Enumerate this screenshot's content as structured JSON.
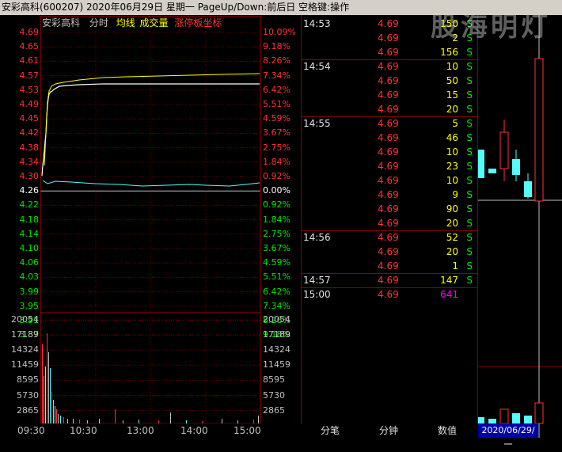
{
  "titlebar": {
    "text": "安彩高科(600207)  2020年06月29日 星期一  PageUp/Down:前后日  空格键:操作"
  },
  "chart_header": {
    "name": "安彩高科",
    "mode": "分时",
    "avg": "均线",
    "volume": "成交量",
    "limit": "涨停板坐标"
  },
  "price_axis": [
    {
      "price": "4.69",
      "pct": "10.09%",
      "color": "red"
    },
    {
      "price": "4.65",
      "pct": "9.18%",
      "color": "red"
    },
    {
      "price": "4.61",
      "pct": "8.26%",
      "color": "red"
    },
    {
      "price": "4.57",
      "pct": "7.34%",
      "color": "red"
    },
    {
      "price": "4.53",
      "pct": "6.42%",
      "color": "red"
    },
    {
      "price": "4.49",
      "pct": "5.51%",
      "color": "red"
    },
    {
      "price": "4.45",
      "pct": "4.59%",
      "color": "red"
    },
    {
      "price": "4.42",
      "pct": "3.67%",
      "color": "red"
    },
    {
      "price": "4.38",
      "pct": "2.75%",
      "color": "red"
    },
    {
      "price": "4.34",
      "pct": "1.84%",
      "color": "red"
    },
    {
      "price": "4.30",
      "pct": "0.92%",
      "color": "red"
    },
    {
      "price": "4.26",
      "pct": "0.00%",
      "color": "white"
    },
    {
      "price": "4.22",
      "pct": "0.92%",
      "color": "green"
    },
    {
      "price": "4.18",
      "pct": "1.84%",
      "color": "green"
    },
    {
      "price": "4.14",
      "pct": "2.75%",
      "color": "green"
    },
    {
      "price": "4.10",
      "pct": "3.67%",
      "color": "green"
    },
    {
      "price": "4.06",
      "pct": "4.59%",
      "color": "green"
    },
    {
      "price": "4.03",
      "pct": "5.51%",
      "color": "green"
    },
    {
      "price": "3.99",
      "pct": "6.42%",
      "color": "green"
    },
    {
      "price": "3.95",
      "pct": "7.34%",
      "color": "green"
    },
    {
      "price": "3.91",
      "pct": "8.26%",
      "color": "green"
    },
    {
      "price": "3.87",
      "pct": "9.18%",
      "color": "green"
    }
  ],
  "volume_axis": [
    "20054",
    "17189",
    "14324",
    "11459",
    "8595",
    "5730",
    "2865"
  ],
  "time_axis": [
    "09:30",
    "10:30",
    "13:00",
    "14:00",
    "15:00"
  ],
  "ticks": [
    {
      "time": "14:53",
      "price": "4.69",
      "vol": "150",
      "side": "S",
      "vc": "yellow"
    },
    {
      "time": "",
      "price": "4.69",
      "vol": "2",
      "side": "S",
      "vc": "yellow"
    },
    {
      "time": "",
      "price": "4.69",
      "vol": "156",
      "side": "S",
      "vc": "yellow"
    },
    {
      "time": "14:54",
      "price": "4.69",
      "vol": "10",
      "side": "S",
      "vc": "yellow"
    },
    {
      "time": "",
      "price": "4.69",
      "vol": "50",
      "side": "S",
      "vc": "yellow"
    },
    {
      "time": "",
      "price": "4.69",
      "vol": "15",
      "side": "S",
      "vc": "yellow"
    },
    {
      "time": "",
      "price": "4.69",
      "vol": "20",
      "side": "S",
      "vc": "yellow"
    },
    {
      "time": "14:55",
      "price": "4.69",
      "vol": "5",
      "side": "S",
      "vc": "yellow"
    },
    {
      "time": "",
      "price": "4.69",
      "vol": "46",
      "side": "S",
      "vc": "yellow"
    },
    {
      "time": "",
      "price": "4.69",
      "vol": "10",
      "side": "S",
      "vc": "yellow"
    },
    {
      "time": "",
      "price": "4.69",
      "vol": "23",
      "side": "S",
      "vc": "yellow"
    },
    {
      "time": "",
      "price": "4.69",
      "vol": "10",
      "side": "S",
      "vc": "yellow"
    },
    {
      "time": "",
      "price": "4.69",
      "vol": "9",
      "side": "S",
      "vc": "yellow"
    },
    {
      "time": "",
      "price": "4.69",
      "vol": "90",
      "side": "S",
      "vc": "yellow"
    },
    {
      "time": "",
      "price": "4.69",
      "vol": "20",
      "side": "S",
      "vc": "yellow"
    },
    {
      "time": "14:56",
      "price": "4.69",
      "vol": "52",
      "side": "S",
      "vc": "yellow"
    },
    {
      "time": "",
      "price": "4.69",
      "vol": "20",
      "side": "S",
      "vc": "yellow"
    },
    {
      "time": "",
      "price": "4.69",
      "vol": "1",
      "side": "S",
      "vc": "yellow"
    },
    {
      "time": "14:57",
      "price": "4.69",
      "vol": "147",
      "side": "S",
      "vc": "yellow"
    },
    {
      "time": "15:00",
      "price": "4.69",
      "vol": "641",
      "side": "",
      "vc": "magenta"
    }
  ],
  "bottom_tabs": [
    "分笔",
    "分钟",
    "数值"
  ],
  "kline_date": "2020/06/29/一",
  "watermark": "股海明灯",
  "colors": {
    "up": "#ff3232",
    "down": "#00e600",
    "avg": "#ffff00",
    "grid": "#8b0000",
    "bg": "#000000"
  }
}
